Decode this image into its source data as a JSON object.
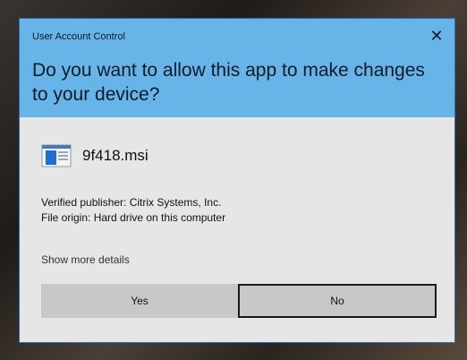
{
  "dialog": {
    "window_title": "User Account Control",
    "close_symbol": "✕",
    "question": "Do you want to allow this app to make changes to your device?",
    "app": {
      "name": "9f418.msi",
      "icon": "installer-icon"
    },
    "publisher_line": "Verified publisher: Citrix Systems, Inc.",
    "origin_line": "File origin: Hard drive on this computer",
    "show_more": "Show more details",
    "buttons": {
      "yes": "Yes",
      "no": "No"
    }
  },
  "colors": {
    "header": "#66b4e8",
    "body": "#e6e6e6",
    "button": "#c8c8c8"
  }
}
